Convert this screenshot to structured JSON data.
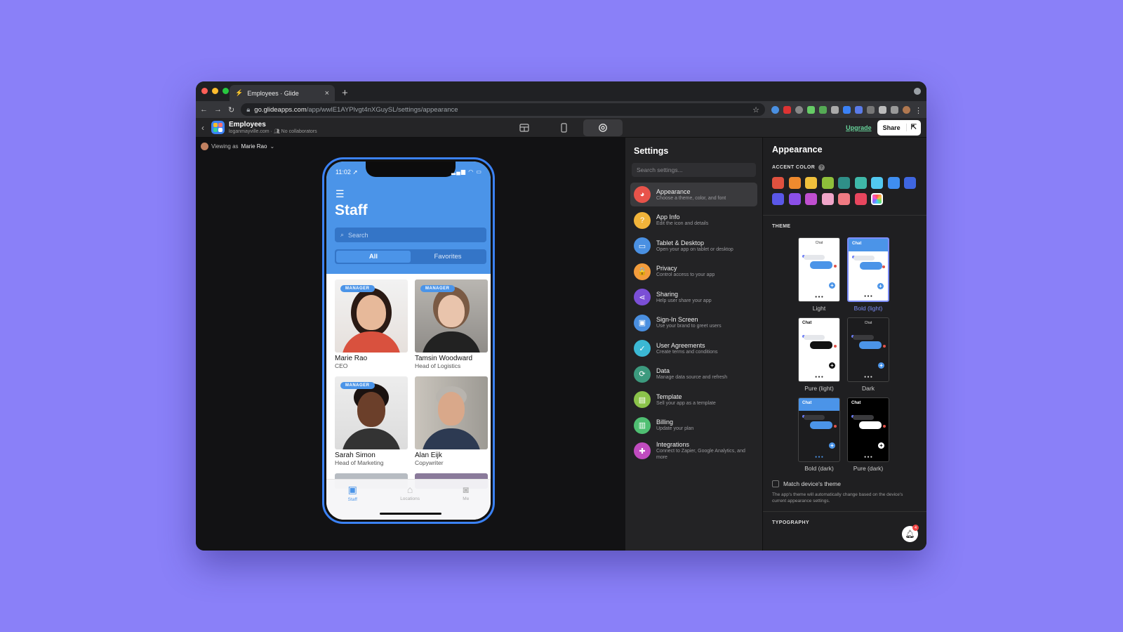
{
  "browser": {
    "tab_title": "Employees · Glide",
    "url_host": "go.glideapps.com",
    "url_path": "/app/wwlE1AYPlvgt4nXGuySL/settings/appearance"
  },
  "app_header": {
    "title": "Employees",
    "domain": "loganmayville.com",
    "collaborators": "No collaborators",
    "upgrade_label": "Upgrade",
    "share_label": "Share"
  },
  "canvas": {
    "viewing_prefix": "Viewing as",
    "viewing_user": "Marie Rao"
  },
  "phone": {
    "time": "11:02",
    "screen_title": "Staff",
    "search_placeholder": "Search",
    "segments": [
      "All",
      "Favorites"
    ],
    "badge_label": "MANAGER",
    "employees": [
      {
        "name": "Marie Rao",
        "role": "CEO",
        "manager": true
      },
      {
        "name": "Tamsin Woodward",
        "role": "Head of Logistics",
        "manager": true
      },
      {
        "name": "Sarah Simon",
        "role": "Head of Marketing",
        "manager": true
      },
      {
        "name": "Alan Eijk",
        "role": "Copywriter",
        "manager": false
      }
    ],
    "tabs": [
      "Staff",
      "Locations",
      "Me"
    ]
  },
  "settings": {
    "title": "Settings",
    "search_placeholder": "Search settings...",
    "items": [
      {
        "label": "Appearance",
        "desc": "Choose a theme, color, and font",
        "color": "#e8534a",
        "icon": "palette-icon",
        "glyph": "◕"
      },
      {
        "label": "App Info",
        "desc": "Edit the icon and details",
        "color": "#f2b43a",
        "icon": "info-icon",
        "glyph": "?"
      },
      {
        "label": "Tablet & Desktop",
        "desc": "Open your app on tablet or desktop",
        "color": "#4a90e2",
        "icon": "desktop-icon",
        "glyph": "▭"
      },
      {
        "label": "Privacy",
        "desc": "Control access to your app",
        "color": "#f39c3c",
        "icon": "lock-icon",
        "glyph": "🔒"
      },
      {
        "label": "Sharing",
        "desc": "Help user share your app",
        "color": "#7b4fd6",
        "icon": "share-icon",
        "glyph": "⋖"
      },
      {
        "label": "Sign-In Screen",
        "desc": "Use your brand to greet users",
        "color": "#4a8fe0",
        "icon": "signin-icon",
        "glyph": "▣"
      },
      {
        "label": "User Agreements",
        "desc": "Create terms and conditions",
        "color": "#3bb8d4",
        "icon": "check-icon",
        "glyph": "✓"
      },
      {
        "label": "Data",
        "desc": "Manage data source and refresh",
        "color": "#3c9a7e",
        "icon": "data-icon",
        "glyph": "⟳"
      },
      {
        "label": "Template",
        "desc": "Sell your app as a template",
        "color": "#8bc34a",
        "icon": "template-icon",
        "glyph": "▤"
      },
      {
        "label": "Billing",
        "desc": "Update your plan",
        "color": "#4fbf72",
        "icon": "billing-icon",
        "glyph": "▥"
      },
      {
        "label": "Integrations",
        "desc": "Connect to Zapier, Google Analytics, and more",
        "color": "#c04bbf",
        "icon": "puzzle-icon",
        "glyph": "✚"
      }
    ]
  },
  "appearance": {
    "title": "Appearance",
    "accent_label": "ACCENT COLOR",
    "accent_colors": [
      "#e0513f",
      "#ef8a2e",
      "#f0c03c",
      "#8fbf3a",
      "#2f8f88",
      "#3fb8a8",
      "#52c8f0",
      "#3f8ef0",
      "#3f66e0",
      "#5a57e8",
      "#8b4fe8",
      "#c04fd0",
      "#f0a5c8",
      "#f07a82",
      "#e8465e"
    ],
    "theme_label": "THEME",
    "themes": [
      {
        "name": "Light",
        "header": "Chat",
        "selected": false
      },
      {
        "name": "Bold (light)",
        "header": "Chat",
        "selected": true
      },
      {
        "name": "Pure (light)",
        "header": "Chat",
        "selected": false
      },
      {
        "name": "Dark",
        "header": "Chat",
        "selected": false
      },
      {
        "name": "Bold (dark)",
        "header": "Chat",
        "selected": false
      },
      {
        "name": "Pure (dark)",
        "header": "Chat",
        "selected": false
      }
    ],
    "match_label": "Match device's theme",
    "match_note": "The app's theme will automatically change based on the device's current appearance settings.",
    "typography_label": "TYPOGRAPHY",
    "notification_count": "4"
  }
}
